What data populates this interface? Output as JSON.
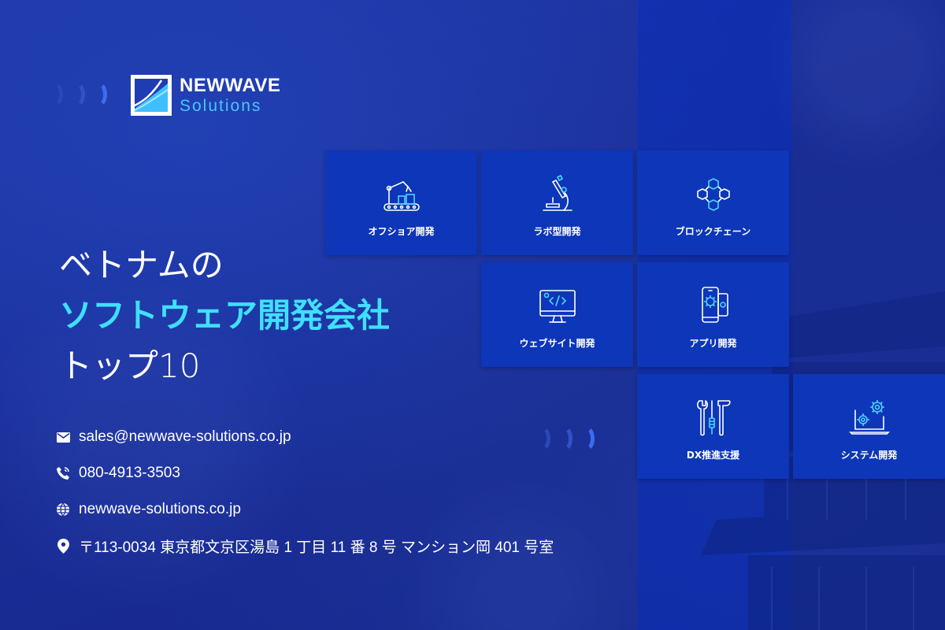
{
  "logo": {
    "name_line1": "NEWWAVE",
    "name_line2": "Solutions"
  },
  "headline": {
    "line1": "ベトナムの",
    "line2": "ソフトウェア開発会社",
    "line3": "トップ10"
  },
  "contacts": {
    "email": "sales@newwave-solutions.co.jp",
    "phone": "080-4913-3503",
    "website": "newwave-solutions.co.jp",
    "address": "〒113-0034 東京都文京区湯島 1 丁目 11 番 8 号 マンション岡 401 号室"
  },
  "services": [
    {
      "label": "オフショア開発",
      "icon": "robot-arm-icon"
    },
    {
      "label": "ラボ型開発",
      "icon": "microscope-icon"
    },
    {
      "label": "ブロックチェーン",
      "icon": "blockchain-cubes-icon"
    },
    {
      "label": "ウェブサイト開発",
      "icon": "monitor-code-icon"
    },
    {
      "label": "アプリ開発",
      "icon": "mobile-gear-icon"
    },
    {
      "label": "DX推進支援",
      "icon": "tools-icon"
    },
    {
      "label": "システム開発",
      "icon": "laptop-gears-icon"
    }
  ],
  "colors": {
    "background": "#1a2f9a",
    "tile": "#0d36b8",
    "accent_cyan": "#3fe0ff",
    "logo_blue": "#46c6ff",
    "icon_cyan": "#4fd2ff"
  }
}
